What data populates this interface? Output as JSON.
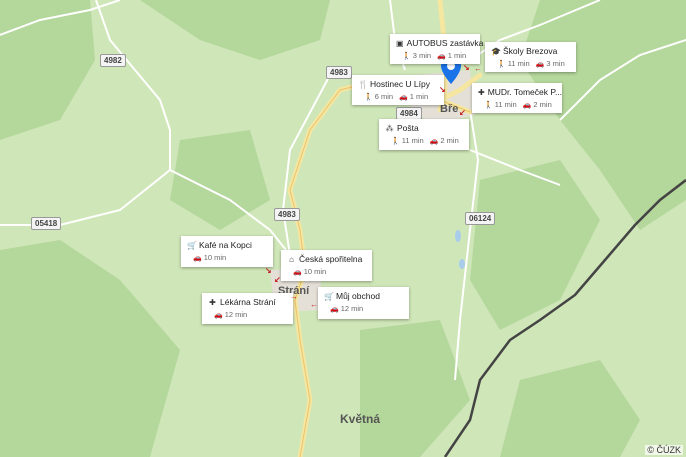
{
  "map": {
    "attribution": "© ČÚZK",
    "towns": [
      {
        "id": "brezova",
        "label": "Bře"
      },
      {
        "id": "strani",
        "label": "Strání"
      },
      {
        "id": "kvetna",
        "label": "Květná"
      }
    ],
    "roads": [
      "4982",
      "4983",
      "4984",
      "4983",
      "05418",
      "06124"
    ]
  },
  "pois": [
    {
      "id": "autobus",
      "name": "AUTOBUS zastávka",
      "icon": "bus-icon",
      "walk": "3 min",
      "car": "1 min"
    },
    {
      "id": "skoly",
      "name": "Školy Brezova",
      "icon": "school-icon",
      "walk": "11 min",
      "car": "3 min"
    },
    {
      "id": "hostinec",
      "name": "Hostinec U Lípy",
      "icon": "restaurant-icon",
      "walk": "6 min",
      "car": "1 min"
    },
    {
      "id": "mudr",
      "name": "MUDr. Tomeček P...",
      "icon": "medical-icon",
      "walk": "11 min",
      "car": "2 min"
    },
    {
      "id": "posta",
      "name": "Pošta",
      "icon": "post-icon",
      "walk": "11 min",
      "car": "2 min"
    },
    {
      "id": "kafe",
      "name": "Kafé na Kopci",
      "icon": "cart-icon",
      "car": "10 min"
    },
    {
      "id": "sporitelna",
      "name": "Česká spořitelna",
      "icon": "bank-icon",
      "car": "10 min"
    },
    {
      "id": "lekarna",
      "name": "Lékárna Strání",
      "icon": "medical-icon",
      "car": "12 min"
    },
    {
      "id": "obchod",
      "name": "Můj obchod",
      "icon": "cart-icon",
      "car": "12 min"
    }
  ]
}
